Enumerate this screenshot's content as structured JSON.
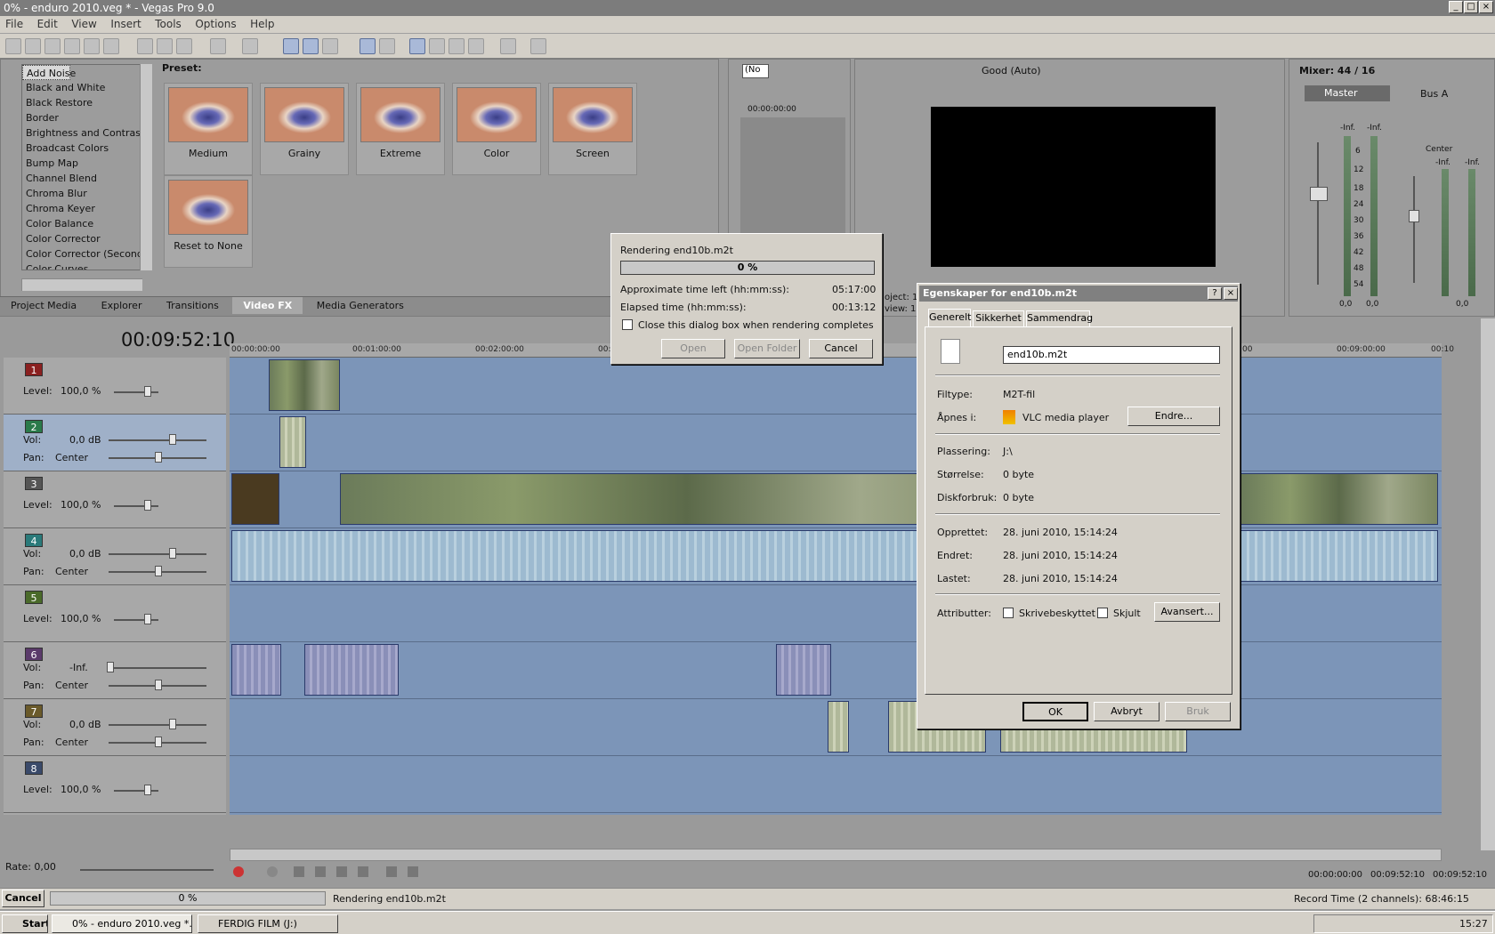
{
  "window": {
    "title": "0% - enduro 2010.veg * - Vegas Pro 9.0"
  },
  "menu": [
    "File",
    "Edit",
    "View",
    "Insert",
    "Tools",
    "Options",
    "Help"
  ],
  "fx_list": {
    "items": [
      "Add Noise",
      "Black and White",
      "Black Restore",
      "Border",
      "Brightness and Contrast",
      "Broadcast Colors",
      "Bump Map",
      "Channel Blend",
      "Chroma Blur",
      "Chroma Keyer",
      "Color Balance",
      "Color Corrector",
      "Color Corrector (Secondary)",
      "Color Curves"
    ],
    "selected": "Add Noise"
  },
  "preset": {
    "label": "Preset:",
    "items": [
      "Medium",
      "Grainy",
      "Extreme",
      "Color",
      "Screen",
      "Reset to None"
    ]
  },
  "bottom_tabs": [
    "Project Media",
    "Explorer",
    "Transitions",
    "Video FX",
    "Media Generators"
  ],
  "active_tab": "Video FX",
  "trimmer": {
    "timecode": "00:00:00:00",
    "dropdown": "(No"
  },
  "preview": {
    "quality": "Good (Auto)",
    "project_label": "oject: 1",
    "view_label": "view: 1"
  },
  "mixer": {
    "title": "Mixer: 44 / 16",
    "master": "Master",
    "bus": "Bus A",
    "center": "Center",
    "inf": "-Inf.",
    "scale": [
      "6",
      "12",
      "18",
      "24",
      "30",
      "36",
      "42",
      "48",
      "54"
    ],
    "master_vals": [
      "0,0",
      "0,0"
    ],
    "bus_val": "0,0"
  },
  "timeline": {
    "cursor": "00:09:52:10",
    "ruler": [
      "00:00:00:00",
      "00:01:00:00",
      "00:02:00:00",
      "00:0",
      "00:09:00:00",
      "00:10",
      "00"
    ],
    "tracks": [
      {
        "num": "1",
        "type": "video",
        "color": "#8a2020",
        "rows": [
          [
            "Level:",
            "100,0 %"
          ]
        ]
      },
      {
        "num": "2",
        "type": "audio",
        "color": "#2a7a4a",
        "rows": [
          [
            "Vol:",
            "0,0 dB"
          ],
          [
            "Pan:",
            "Center"
          ]
        ]
      },
      {
        "num": "3",
        "type": "video",
        "color": "#555",
        "rows": [
          [
            "Level:",
            "100,0 %"
          ]
        ]
      },
      {
        "num": "4",
        "type": "audio",
        "color": "#2a7a7a",
        "rows": [
          [
            "Vol:",
            "0,0 dB"
          ],
          [
            "Pan:",
            "Center"
          ]
        ]
      },
      {
        "num": "5",
        "type": "video",
        "color": "#4a6a2a",
        "rows": [
          [
            "Level:",
            "100,0 %"
          ]
        ]
      },
      {
        "num": "6",
        "type": "audio",
        "color": "#5a3a6a",
        "rows": [
          [
            "Vol:",
            "-Inf."
          ],
          [
            "Pan:",
            "Center"
          ]
        ]
      },
      {
        "num": "7",
        "type": "audio",
        "color": "#6a5a2a",
        "rows": [
          [
            "Vol:",
            "0,0 dB"
          ],
          [
            "Pan:",
            "Center"
          ]
        ]
      },
      {
        "num": "8",
        "type": "video",
        "color": "#3a4a6a",
        "rows": [
          [
            "Level:",
            "100,0 %"
          ]
        ]
      }
    ],
    "rate": "Rate: 0,00",
    "times": [
      "00:00:00:00",
      "00:09:52:10",
      "00:09:52:10"
    ]
  },
  "render_dialog": {
    "title": "Rendering end10b.m2t",
    "progress": "0 %",
    "progress_value": 0,
    "time_left_label": "Approximate time left (hh:mm:ss):",
    "time_left": "05:17:00",
    "elapsed_label": "Elapsed time (hh:mm:ss):",
    "elapsed": "00:13:12",
    "close_checkbox": "Close this dialog box when rendering completes",
    "open": "Open",
    "open_folder": "Open Folder",
    "cancel": "Cancel"
  },
  "props_dialog": {
    "title": "Egenskaper for end10b.m2t",
    "tabs": [
      "Generelt",
      "Sikkerhet",
      "Sammendrag"
    ],
    "filename": "end10b.m2t",
    "rows": [
      [
        "Filtype:",
        "M2T-fil"
      ],
      [
        "Åpnes i:",
        "VLC media player"
      ],
      [
        "Plassering:",
        "J:\\"
      ],
      [
        "Størrelse:",
        "0 byte"
      ],
      [
        "Diskforbruk:",
        "0 byte"
      ],
      [
        "Opprettet:",
        "28. juni 2010, 15:14:24"
      ],
      [
        "Endret:",
        "28. juni 2010, 15:14:24"
      ],
      [
        "Lastet:",
        "28. juni 2010, 15:14:24"
      ]
    ],
    "change": "Endre...",
    "attr_label": "Attributter:",
    "readonly": "Skrivebeskyttet",
    "hidden": "Skjult",
    "advanced": "Avansert...",
    "ok": "OK",
    "cancel": "Avbryt",
    "apply": "Bruk"
  },
  "status": {
    "cancel": "Cancel",
    "progress": "0 %",
    "text": "Rendering end10b.m2t",
    "record": "Record Time (2 channels): 68:46:15"
  },
  "taskbar": {
    "start": "Start",
    "items": [
      "0% - enduro 2010.veg *...",
      "FERDIG FILM (J:)"
    ],
    "clock": "15:27"
  }
}
